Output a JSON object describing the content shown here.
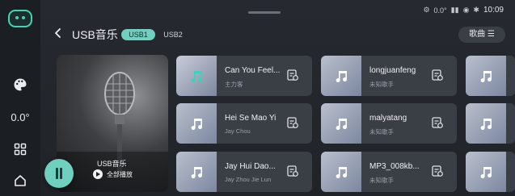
{
  "status": {
    "temperature": "0.0°",
    "time": "10:09"
  },
  "header": {
    "title": "USB音乐",
    "tabs": [
      {
        "label": "USB1",
        "active": true
      },
      {
        "label": "USB2",
        "active": false
      }
    ],
    "song_list_button": "歌曲 ☰"
  },
  "rail": {
    "temperature": "0.0°",
    "icons": [
      "robot-icon",
      "palette-icon",
      "grid-icon",
      "home-icon"
    ]
  },
  "now_playing": {
    "source_label": "USB音乐",
    "play_all_label": "全部播放",
    "state": "playing"
  },
  "tracks": [
    {
      "title": "Can You Feel...",
      "artist": "主力客"
    },
    {
      "title": "longjuanfeng",
      "artist": "未知歌手"
    },
    {
      "title": "",
      "artist": ""
    },
    {
      "title": "Hei Se Mao Yi",
      "artist": "Jay Chou"
    },
    {
      "title": "malyatang",
      "artist": "未知歌手"
    },
    {
      "title": "",
      "artist": ""
    },
    {
      "title": "Jay Hui Dao...",
      "artist": "Jay Zhou Jie Lun"
    },
    {
      "title": "MP3_008kb...",
      "artist": "未知歌手"
    },
    {
      "title": "",
      "artist": ""
    }
  ],
  "colors": {
    "accent": "#6fd0c0",
    "background": "#202328",
    "card": "#3a3e45"
  }
}
